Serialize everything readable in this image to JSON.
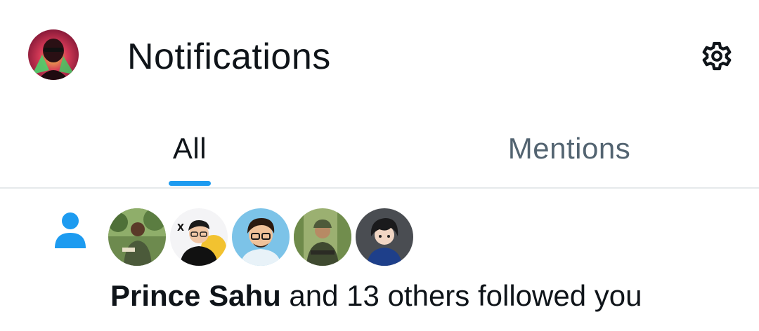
{
  "header": {
    "title": "Notifications",
    "avatar_icon": "profile-avatar",
    "settings_icon": "gear-icon"
  },
  "tabs": [
    {
      "label": "All",
      "active": true
    },
    {
      "label": "Mentions",
      "active": false
    }
  ],
  "notification": {
    "type_icon": "person-icon",
    "name": "Prince Sahu",
    "message": " and 13 others followed you",
    "avatars": [
      "follower-avatar-1",
      "follower-avatar-2",
      "follower-avatar-3",
      "follower-avatar-4",
      "follower-avatar-5"
    ]
  },
  "colors": {
    "accent": "#1d9bf0",
    "text_primary": "#0f1419",
    "text_secondary": "#536471",
    "divider": "#e6e9eb"
  }
}
